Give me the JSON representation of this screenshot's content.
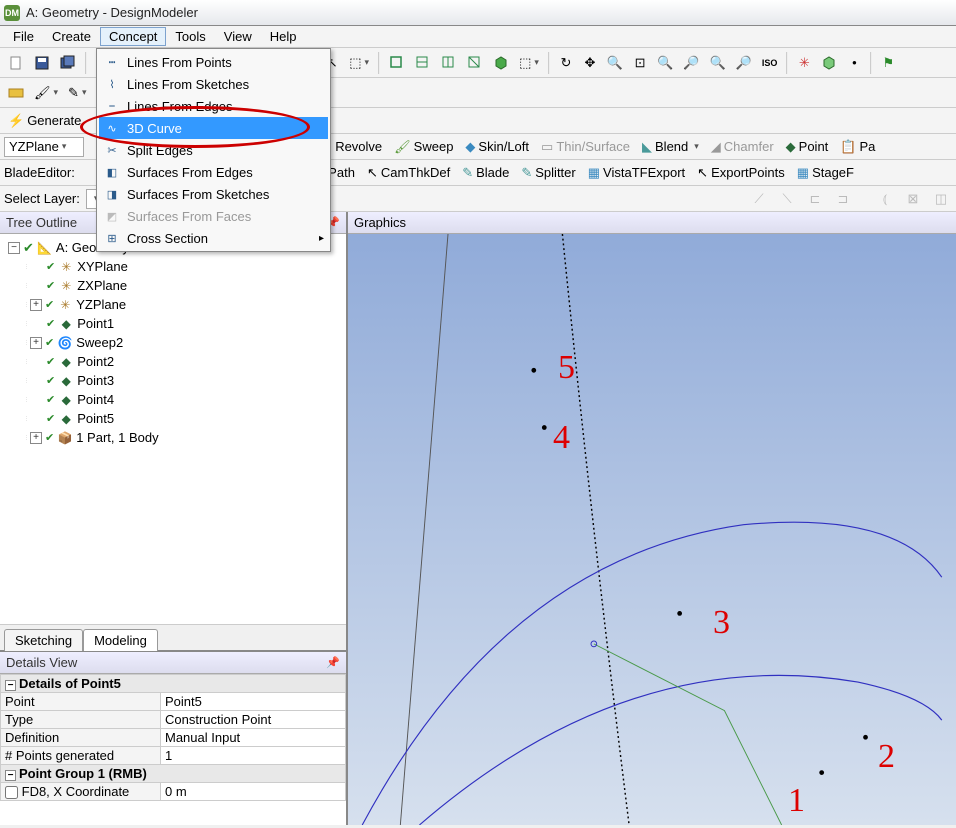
{
  "title": "A: Geometry - DesignModeler",
  "app_icon_text": "DM",
  "menubar": [
    "File",
    "Create",
    "Concept",
    "Tools",
    "View",
    "Help"
  ],
  "open_menu_index": 2,
  "concept_menu": [
    {
      "label": "Lines From Points",
      "icon": "┅"
    },
    {
      "label": "Lines From Sketches",
      "icon": "⌇"
    },
    {
      "label": "Lines From Edges",
      "icon": "⎯"
    },
    {
      "label": "3D Curve",
      "icon": "∿",
      "highlight": true
    },
    {
      "label": "Split Edges",
      "icon": "✂"
    },
    {
      "label": "Surfaces From Edges",
      "icon": "◧"
    },
    {
      "label": "Surfaces From Sketches",
      "icon": "◨"
    },
    {
      "label": "Surfaces From Faces",
      "icon": "◩",
      "disabled": true
    },
    {
      "label": "Cross Section",
      "icon": "⊞",
      "submenu": true
    }
  ],
  "row2": {
    "plane": "YZPlane",
    "thinsurface": "Thin/Surface",
    "blend": "Blend",
    "chamfer": "Chamfer",
    "point": "Point",
    "revolve": "Revolve",
    "sweep": "Sweep",
    "skinloft": "Skin/Loft",
    "generate": "Generate"
  },
  "row3": {
    "bladeeditor": "BladeEditor:",
    "flowpath": "FlowPath",
    "camthkdef": "CamThkDef",
    "blade": "Blade",
    "splitter": "Splitter",
    "vistatf": "VistaTFExport",
    "exportpoints": "ExportPoints",
    "stage": "StageF"
  },
  "row4": {
    "selectlayer": "Select Layer:"
  },
  "tree_outline_title": "Tree Outline",
  "tree": {
    "root": "A: Geometry",
    "items": [
      {
        "l": "XYPlane",
        "i": "✳",
        "c": "#aa7a2a"
      },
      {
        "l": "ZXPlane",
        "i": "✳",
        "c": "#aa7a2a"
      },
      {
        "l": "YZPlane",
        "i": "✳",
        "c": "#aa7a2a",
        "exp": "+"
      },
      {
        "l": "Point1",
        "i": "◆",
        "c": "#2a6a3a"
      },
      {
        "l": "Sweep2",
        "i": "🌀",
        "c": "#2aa9aa",
        "exp": "+"
      },
      {
        "l": "Point2",
        "i": "◆",
        "c": "#2a6a3a"
      },
      {
        "l": "Point3",
        "i": "◆",
        "c": "#2a6a3a"
      },
      {
        "l": "Point4",
        "i": "◆",
        "c": "#2a6a3a"
      },
      {
        "l": "Point5",
        "i": "◆",
        "c": "#2a6a3a"
      },
      {
        "l": "1 Part, 1 Body",
        "i": "📦",
        "c": "#2a5aa0",
        "exp": "+"
      }
    ]
  },
  "tabs": {
    "sketching": "Sketching",
    "modeling": "Modeling"
  },
  "details_title": "Details View",
  "details": {
    "group1": "Details of Point5",
    "rows": [
      [
        "Point",
        "Point5"
      ],
      [
        "Type",
        "Construction Point"
      ],
      [
        "Definition",
        "Manual Input"
      ],
      [
        "# Points generated",
        "1"
      ]
    ],
    "group2": "Point Group 1  (RMB)",
    "row2": [
      "FD8, X Coordinate",
      "0 m"
    ]
  },
  "graphics_title": "Graphics",
  "annotations": {
    "p1": "1",
    "p2": "2",
    "p3": "3",
    "p4": "4",
    "p5": "5"
  }
}
